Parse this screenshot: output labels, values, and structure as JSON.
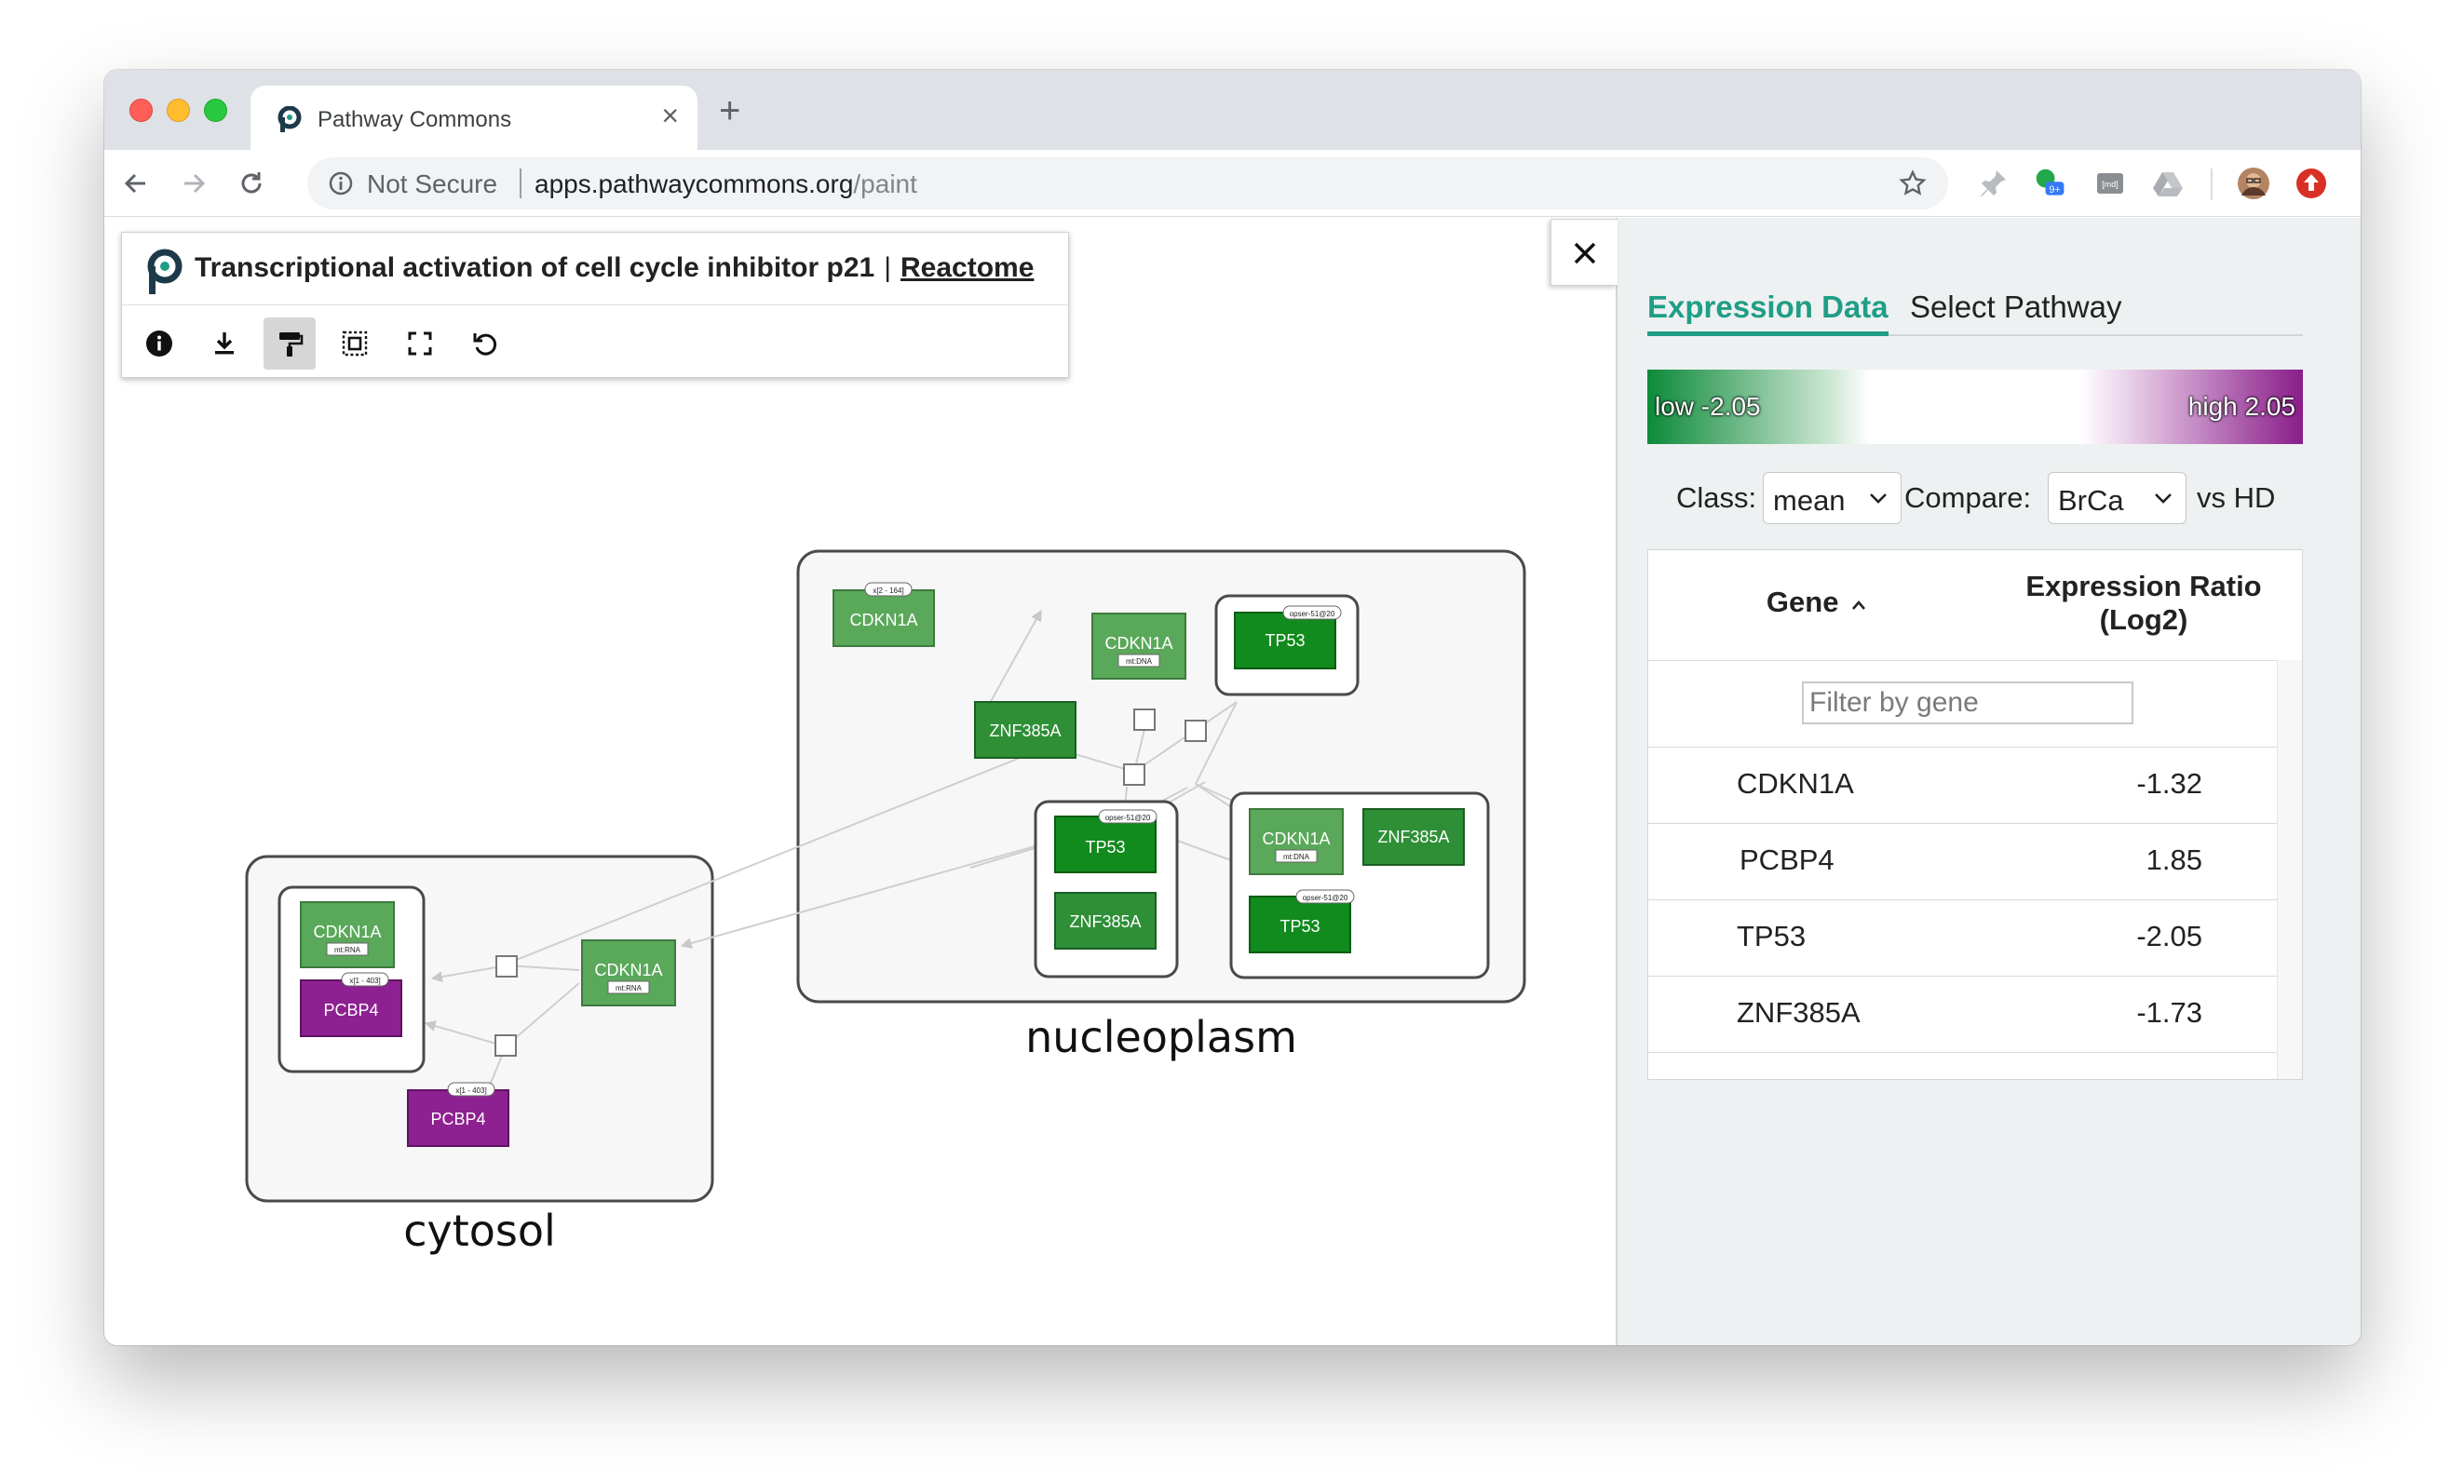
{
  "browser": {
    "tab_title": "Pathway Commons",
    "security_label": "Not Secure",
    "url_host": "apps.pathwaycommons.org",
    "url_path": "/paint",
    "extension_badge": "9+",
    "md_extension_label": "[md]"
  },
  "app": {
    "pathway_title": "Transcriptional activation of cell cycle inhibitor p21",
    "separator": "|",
    "source_link": "Reactome"
  },
  "graph": {
    "compartments": [
      {
        "name": "nucleoplasm"
      },
      {
        "name": "cytosol"
      }
    ],
    "nodes": [
      {
        "label": "CDKN1A",
        "tag": "x[2 - 164]",
        "color": "#5aa85a"
      },
      {
        "label": "CDKN1A",
        "tag": "mt:DNA",
        "color": "#5aa85a"
      },
      {
        "label": "TP53",
        "tag": "opser-51@20",
        "color": "#118a1e"
      },
      {
        "label": "ZNF385A",
        "tag": "",
        "color": "#2e8f37"
      },
      {
        "label": "TP53",
        "tag": "opser-51@20",
        "color": "#118a1e"
      },
      {
        "label": "ZNF385A",
        "tag": "",
        "color": "#2e8f37"
      },
      {
        "label": "CDKN1A",
        "tag": "mt:DNA",
        "color": "#5aa85a"
      },
      {
        "label": "ZNF385A",
        "tag": "",
        "color": "#2e8f37"
      },
      {
        "label": "TP53",
        "tag": "opser-51@20",
        "color": "#118a1e"
      },
      {
        "label": "CDKN1A",
        "tag": "mt:RNA",
        "color": "#5aa85a"
      },
      {
        "label": "PCBP4",
        "tag": "x[1 - 403]",
        "color": "#8e2192"
      },
      {
        "label": "CDKN1A",
        "tag": "mt:RNA",
        "color": "#5aa85a"
      },
      {
        "label": "PCBP4",
        "tag": "x[1 - 403]",
        "color": "#8e2192"
      }
    ]
  },
  "panel": {
    "tabs": [
      {
        "label": "Expression Data",
        "active": true
      },
      {
        "label": "Select Pathway",
        "active": false
      }
    ],
    "legend": {
      "low_label": "low -2.05",
      "high_label": "high 2.05",
      "low_color": "#0d8a3a",
      "high_color": "#8a1d8a"
    },
    "class_label": "Class:",
    "class_value": "mean",
    "compare_label": "Compare:",
    "compare_value": "BrCa",
    "vs_label": "vs HD",
    "table": {
      "header_gene": "Gene",
      "header_ratio_line1": "Expression Ratio",
      "header_ratio_line2": "(Log2)",
      "filter_placeholder": "Filter by gene",
      "rows": [
        {
          "gene": "CDKN1A",
          "value": "-1.32"
        },
        {
          "gene": "PCBP4",
          "value": "1.85"
        },
        {
          "gene": "TP53",
          "value": "-2.05"
        },
        {
          "gene": "ZNF385A",
          "value": "-1.73"
        }
      ]
    }
  },
  "accent_color": "#1f9e86"
}
